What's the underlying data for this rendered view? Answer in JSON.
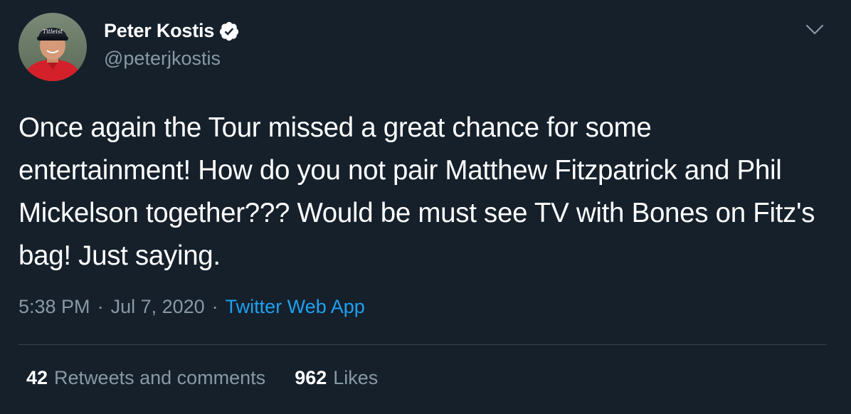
{
  "author": {
    "display_name": "Peter Kostis",
    "handle": "@peterjkostis",
    "verified": true,
    "avatar_icon": "golfer-avatar",
    "cap_logo_text": "Titleist"
  },
  "tweet": {
    "text": "Once again the Tour missed a great chance for some entertainment! How do you not pair Matthew Fitzpatrick and Phil Mickelson together??? Would be must see TV with Bones on Fitz's bag! Just saying.",
    "time": "5:38 PM",
    "separator": "·",
    "date": "Jul 7, 2020",
    "source": "Twitter Web App"
  },
  "stats": {
    "retweets_count": "42",
    "retweets_label": "Retweets and comments",
    "likes_count": "962",
    "likes_label": "Likes"
  },
  "colors": {
    "background": "#15202b",
    "primary_text": "#ffffff",
    "secondary_text": "#8899a6",
    "link": "#1da1f2",
    "divider": "#38444d"
  }
}
